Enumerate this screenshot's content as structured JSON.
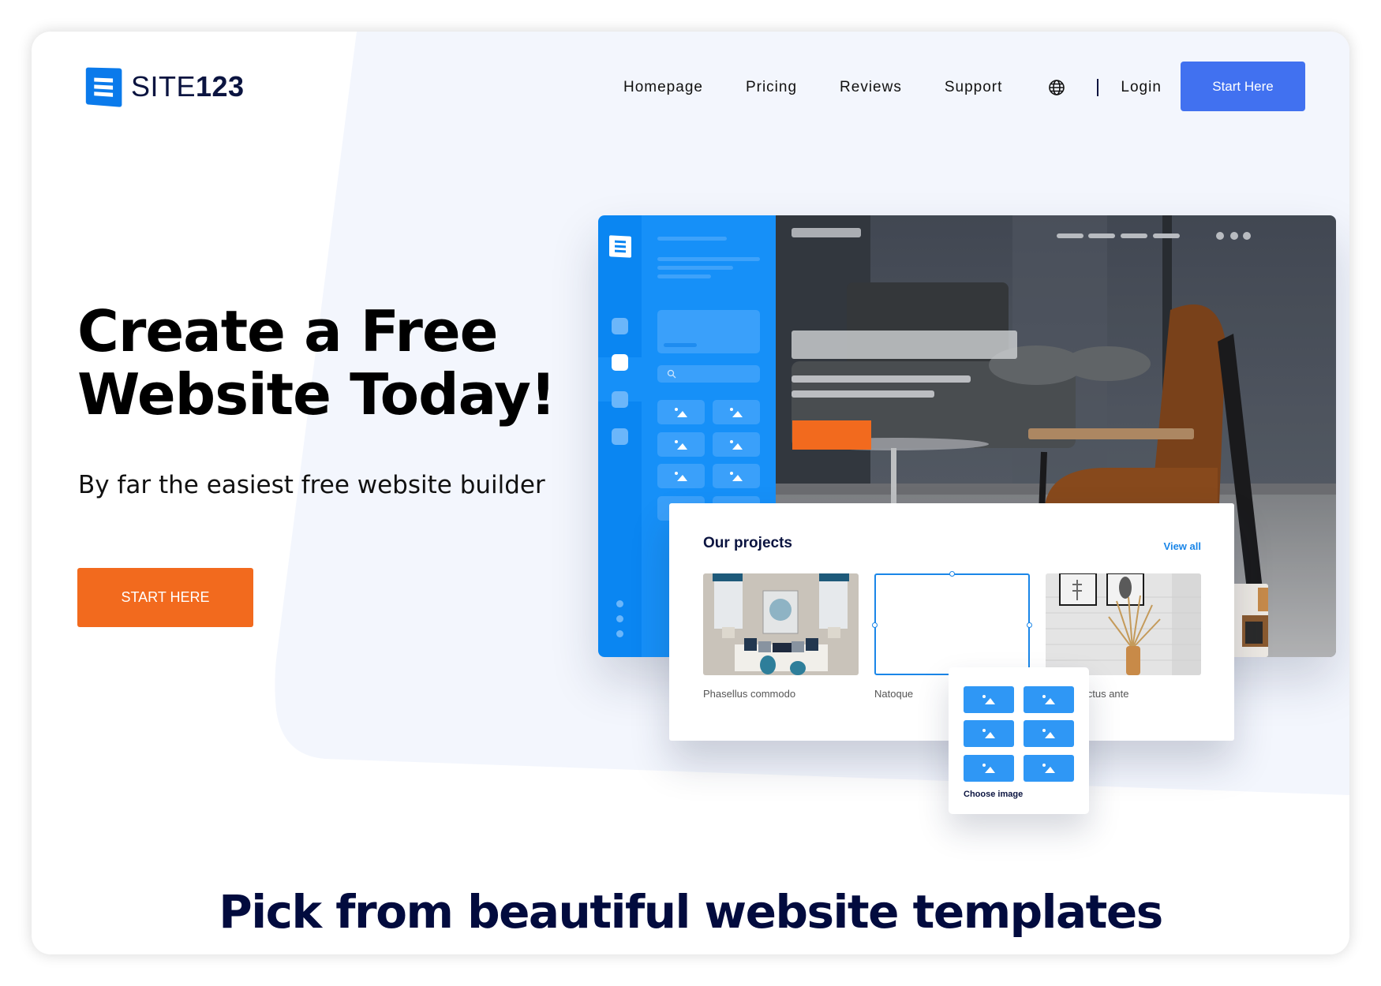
{
  "header": {
    "logo": {
      "text_light": "SITE",
      "text_bold": "123",
      "icon": "site123-logo-icon"
    },
    "nav": [
      {
        "label": "Homepage"
      },
      {
        "label": "Pricing"
      },
      {
        "label": "Reviews"
      },
      {
        "label": "Support"
      }
    ],
    "language_icon": "globe-icon",
    "login_label": "Login",
    "cta_label": "Start Here"
  },
  "hero": {
    "title_line1": "Create a Free",
    "title_line2": "Website Today!",
    "subtitle": "By far the easiest free website builder",
    "cta_label": "START HERE"
  },
  "mockup": {
    "projects": {
      "title": "Our projects",
      "view_all": "View all",
      "items": [
        {
          "caption": "Phasellus commodo"
        },
        {
          "caption": "Natoque"
        },
        {
          "caption": "culis luctus ante"
        }
      ]
    },
    "image_picker": {
      "label": "Choose image",
      "tile_icon": "image-icon"
    }
  },
  "section": {
    "title": "Pick from beautiful website templates"
  },
  "colors": {
    "primary_blue": "#4171F0",
    "editor_blue": "#1690F8",
    "orange": "#F26A1E",
    "navy": "#0B1440",
    "hero_bg": "#F3F6FD"
  }
}
